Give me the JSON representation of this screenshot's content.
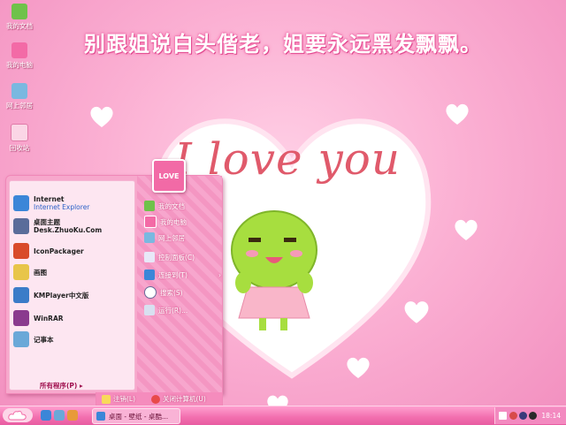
{
  "wallpaper": {
    "headline": "别跟姐说白头偕老，姐要永远黑发飘飘。",
    "love_text": "I love you"
  },
  "desktop_icons": [
    {
      "label": "我的文档",
      "icon": "documents-icon"
    },
    {
      "label": "我的电脑",
      "icon": "computer-icon"
    },
    {
      "label": "网上邻居",
      "icon": "network-icon"
    },
    {
      "label": "回收站",
      "icon": "recycle-bin-icon"
    }
  ],
  "start_menu": {
    "avatar_label": "LOVE",
    "pinned": [
      {
        "title": "Internet",
        "subtitle": "Internet Explorer",
        "icon": "ie-icon"
      },
      {
        "title": "桌面主题",
        "subtitle": "Desk.ZhuoKu.Com",
        "icon": "theme-icon"
      }
    ],
    "programs": [
      {
        "label": "IconPackager",
        "icon": "iconpackager-icon"
      },
      {
        "label": "画图",
        "icon": "paint-icon"
      },
      {
        "label": "KMPlayer中文版",
        "icon": "kmplayer-icon"
      },
      {
        "label": "WinRAR",
        "icon": "winrar-icon"
      },
      {
        "label": "记事本",
        "icon": "notepad-icon"
      }
    ],
    "all_programs": "所有程序(P)",
    "right_items": [
      {
        "label": "我的文档",
        "icon": "documents-icon"
      },
      {
        "label": "我的电脑",
        "icon": "computer-icon"
      },
      {
        "label": "网上邻居",
        "icon": "network-icon"
      },
      {
        "label": "控制面板(C)",
        "icon": "control-panel-icon"
      },
      {
        "label": "连接到(T)",
        "icon": "connect-icon"
      },
      {
        "label": "搜索(S)",
        "icon": "search-icon"
      },
      {
        "label": "运行(R)...",
        "icon": "run-icon"
      }
    ],
    "logoff": "注销(L)",
    "shutdown": "关闭计算机(U)"
  },
  "taskbar": {
    "task": "桌面 - 壁纸 - 桌酷...",
    "clock": "18:14"
  },
  "colors": {
    "accent": "#f26aa6",
    "menu_pink": "#f7a8cc",
    "taskbar": "#f26eae"
  }
}
